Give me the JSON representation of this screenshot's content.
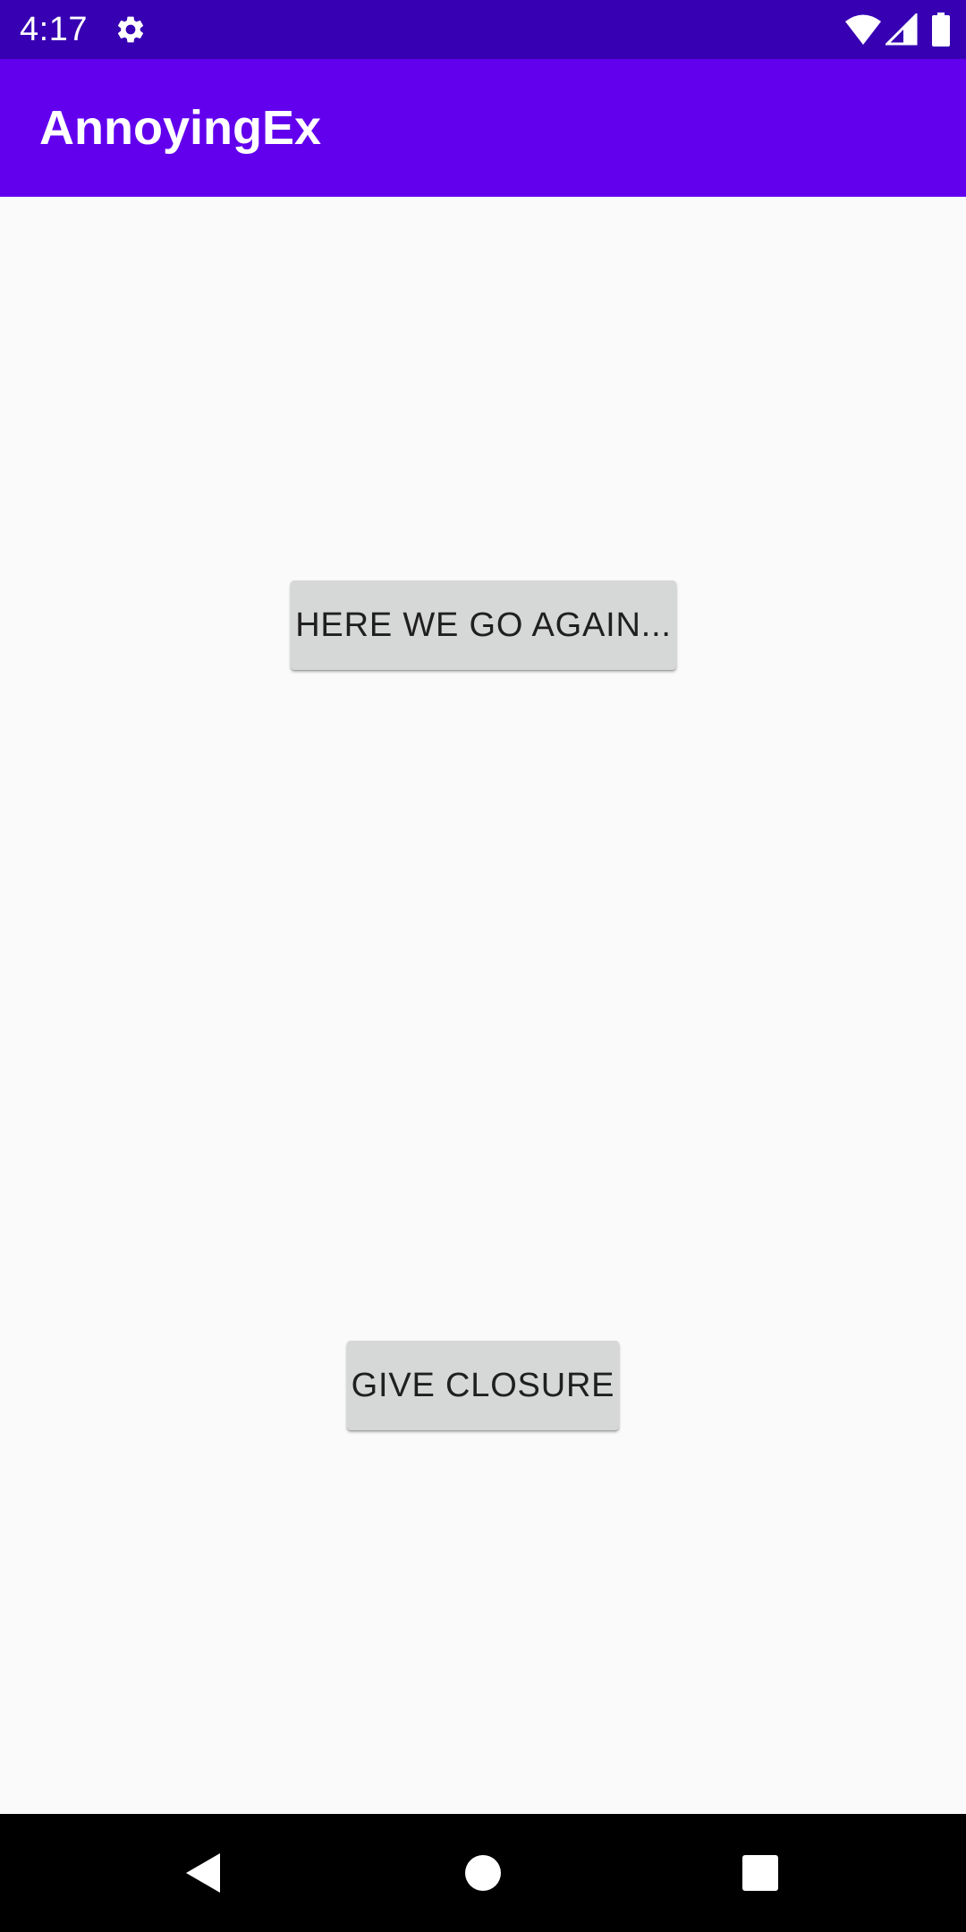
{
  "status_bar": {
    "time": "4:17",
    "icons": [
      "settings-gear-icon",
      "wifi-icon",
      "cell-signal-icon",
      "battery-icon"
    ],
    "background_color": "#3700B3"
  },
  "app_bar": {
    "title": "AnnoyingEx",
    "background_color": "#6200EE"
  },
  "main": {
    "buttons": [
      {
        "label": "HERE WE GO AGAIN..."
      },
      {
        "label": "GIVE CLOSURE"
      }
    ],
    "button_color": "#D6D7D7"
  },
  "nav_bar": {
    "icons": [
      "back-icon",
      "home-icon",
      "recents-icon"
    ]
  }
}
